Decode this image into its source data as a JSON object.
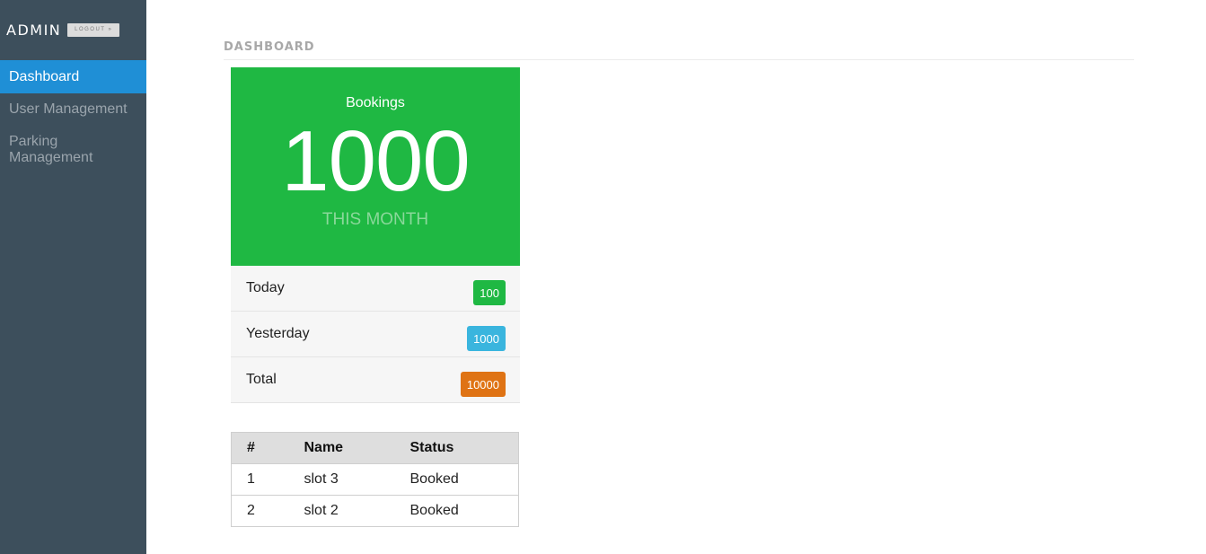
{
  "sidebar": {
    "brand": "ADMIN",
    "logout_label": "LOGOUT »",
    "items": [
      {
        "label": "Dashboard",
        "active": true
      },
      {
        "label": "User Management",
        "active": false
      },
      {
        "label": "Parking Management",
        "active": false
      }
    ]
  },
  "header": {
    "title": "DASHBOARD"
  },
  "bookings": {
    "title": "Bookings",
    "value": "1000",
    "period": "THIS MONTH",
    "card_color": "#1fb843",
    "rows": [
      {
        "label": "Today",
        "value": "100",
        "color": "#1fb843"
      },
      {
        "label": "Yesterday",
        "value": "1000",
        "color": "#3ab5de"
      },
      {
        "label": "Total",
        "value": "10000",
        "color": "#df7314"
      }
    ]
  },
  "slots_table": {
    "columns": [
      "#",
      "Name",
      "Status"
    ],
    "rows": [
      [
        "1",
        "slot 3",
        "Booked"
      ],
      [
        "2",
        "slot 2",
        "Booked"
      ]
    ]
  }
}
